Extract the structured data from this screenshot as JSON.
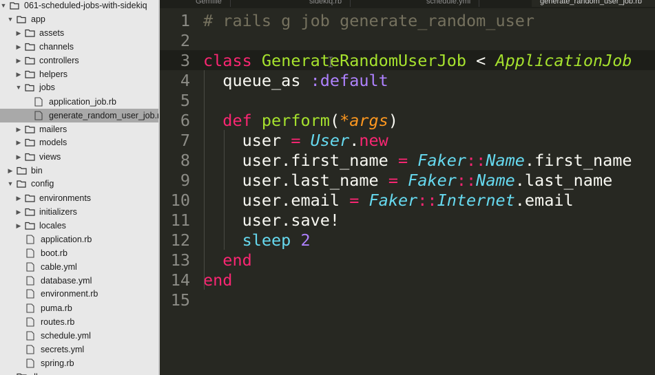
{
  "sidebar": {
    "root": "061-scheduled-jobs-with-sidekiq",
    "app": "app",
    "assets": "assets",
    "channels": "channels",
    "controllers": "controllers",
    "helpers": "helpers",
    "jobs": "jobs",
    "application_job": "application_job.rb",
    "generate_random_user_job": "generate_random_user_job.rb",
    "mailers": "mailers",
    "models": "models",
    "views": "views",
    "bin": "bin",
    "config": "config",
    "environments": "environments",
    "initializers": "initializers",
    "locales": "locales",
    "application_rb": "application.rb",
    "boot_rb": "boot.rb",
    "cable_yml": "cable.yml",
    "database_yml": "database.yml",
    "environment_rb": "environment.rb",
    "puma_rb": "puma.rb",
    "routes_rb": "routes.rb",
    "schedule_yml": "schedule.yml",
    "secrets_yml": "secrets.yml",
    "spring_rb": "spring.rb",
    "db_partial": "db"
  },
  "tabs": [
    "Gemfile",
    "sidekiq.rb",
    "schedule.yml",
    "generate_random_user_job.rb"
  ],
  "editor": {
    "line_numbers": [
      "1",
      "2",
      "3",
      "4",
      "5",
      "6",
      "7",
      "8",
      "9",
      "10",
      "11",
      "12",
      "13",
      "14",
      "15"
    ],
    "l1": "# rails g job generate_random_user",
    "l3_class": "class",
    "l3_name": "GenerateRandomUserJob",
    "l3_lt": " < ",
    "l3_parent": "ApplicationJob",
    "l4_queue": "queue_as",
    "l4_sym": ":default",
    "l6_def": "def",
    "l6_method": "perform",
    "l6_open": "(",
    "l6_arg": "*args",
    "l6_close": ")",
    "user": "user",
    "eq": " = ",
    "User": "User",
    "dot": ".",
    "new": "new",
    "first_name_attr": "user.first_name",
    "last_name_attr": "user.last_name",
    "email_attr": "user.email",
    "Faker": "Faker",
    "sep": "::",
    "Name": "Name",
    "Internet": "Internet",
    "first_name": ".first_name",
    "last_name": ".last_name",
    "email": ".email",
    "save": "user.save!",
    "sleep": "sleep",
    "two": "2",
    "end": "end"
  },
  "colors": {
    "bg": "#272822",
    "keyword": "#f92672",
    "class_name": "#a6e22e",
    "symbol": "#ae81ff",
    "constant": "#66d9ef",
    "argument": "#fd971f",
    "comment": "#75715e"
  }
}
